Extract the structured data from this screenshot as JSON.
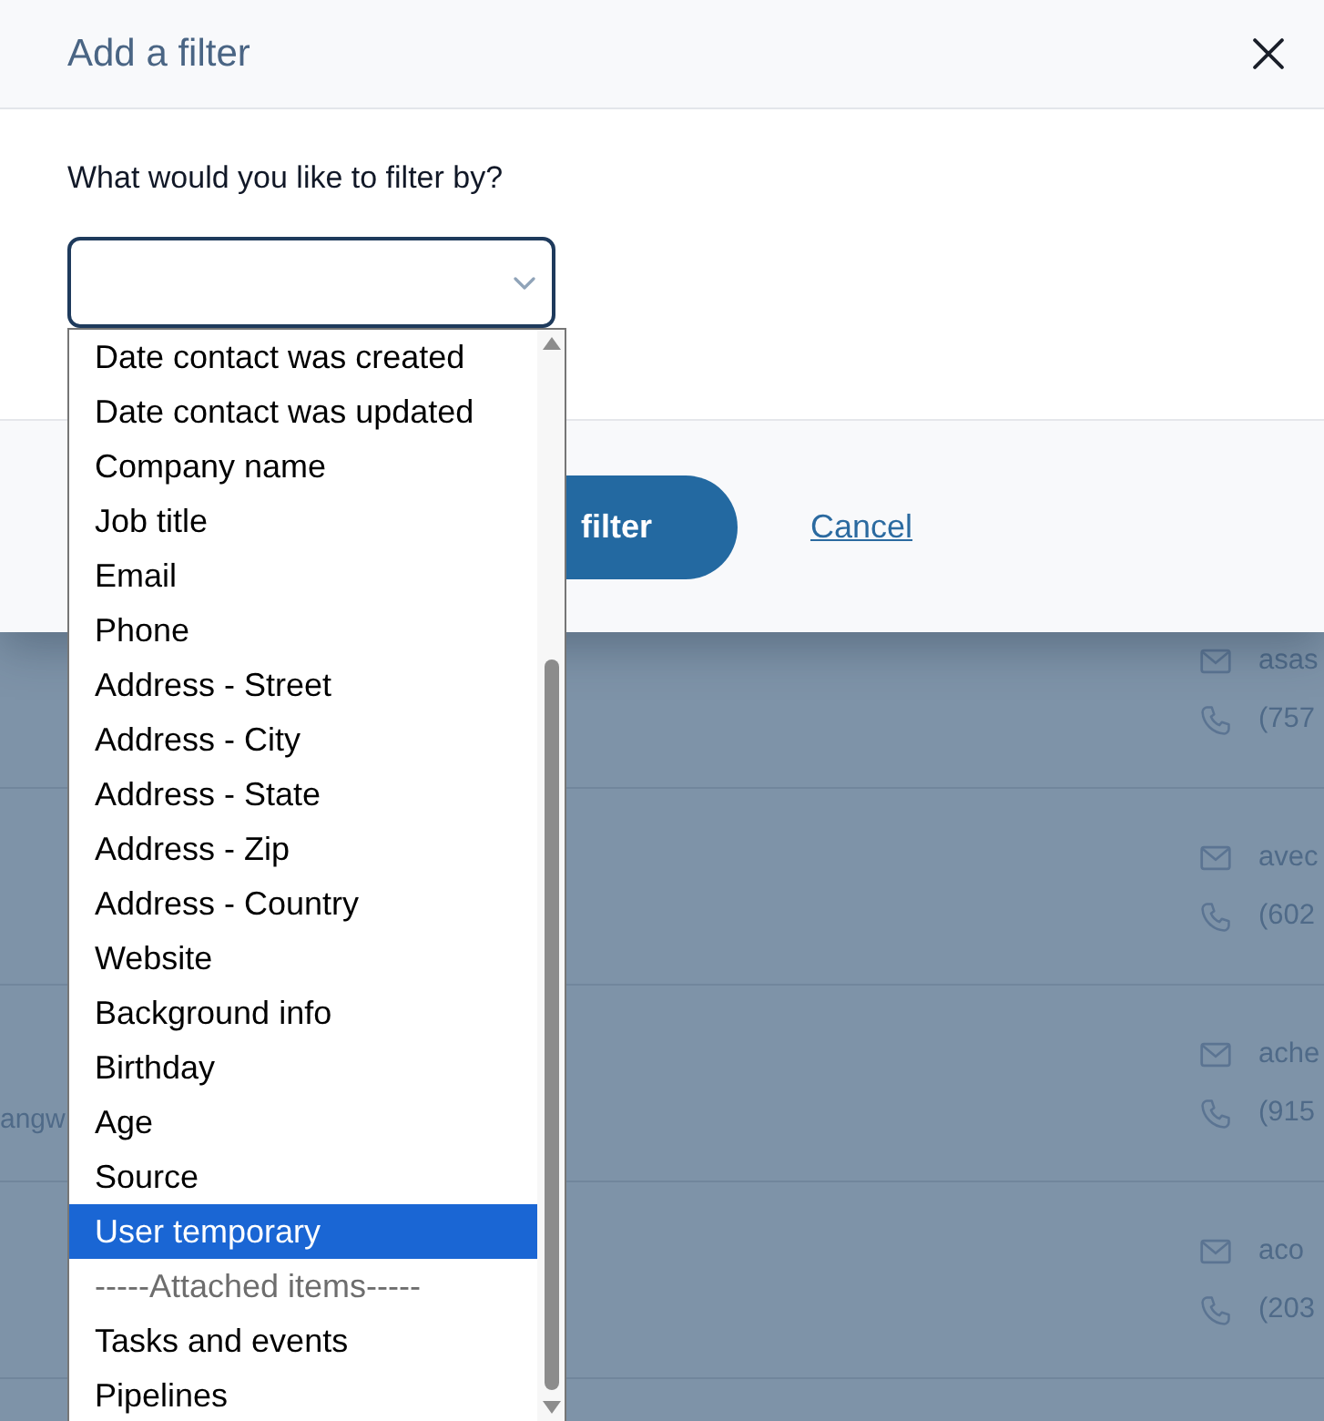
{
  "background_rows": [
    {
      "email": "asas",
      "phone": "(757"
    },
    {
      "email": "avec",
      "phone": "(602"
    },
    {
      "left_text": "angw",
      "email": "ache",
      "phone": "(915"
    },
    {
      "email": "aco",
      "phone": "(203"
    }
  ],
  "dialog": {
    "title": "Add a filter",
    "prompt": "What would you like to filter by?",
    "filter_select": {
      "expanded": true,
      "options": [
        {
          "label": "Date contact was created",
          "selected": false,
          "disabled": false
        },
        {
          "label": "Date contact was updated",
          "selected": false,
          "disabled": false
        },
        {
          "label": "Company name",
          "selected": false,
          "disabled": false
        },
        {
          "label": "Job title",
          "selected": false,
          "disabled": false
        },
        {
          "label": "Email",
          "selected": false,
          "disabled": false
        },
        {
          "label": "Phone",
          "selected": false,
          "disabled": false
        },
        {
          "label": "Address - Street",
          "selected": false,
          "disabled": false
        },
        {
          "label": "Address - City",
          "selected": false,
          "disabled": false
        },
        {
          "label": "Address - State",
          "selected": false,
          "disabled": false
        },
        {
          "label": "Address - Zip",
          "selected": false,
          "disabled": false
        },
        {
          "label": "Address - Country",
          "selected": false,
          "disabled": false
        },
        {
          "label": "Website",
          "selected": false,
          "disabled": false
        },
        {
          "label": "Background info",
          "selected": false,
          "disabled": false
        },
        {
          "label": "Birthday",
          "selected": false,
          "disabled": false
        },
        {
          "label": "Age",
          "selected": false,
          "disabled": false
        },
        {
          "label": "Source",
          "selected": false,
          "disabled": false
        },
        {
          "label": "User temporary",
          "selected": true,
          "disabled": false
        },
        {
          "label": "-----Attached items-----",
          "selected": false,
          "disabled": true
        },
        {
          "label": "Tasks and events",
          "selected": false,
          "disabled": false
        },
        {
          "label": "Pipelines",
          "selected": false,
          "disabled": false
        }
      ]
    },
    "footer": {
      "apply_button": "filter",
      "cancel_link": "Cancel"
    }
  }
}
